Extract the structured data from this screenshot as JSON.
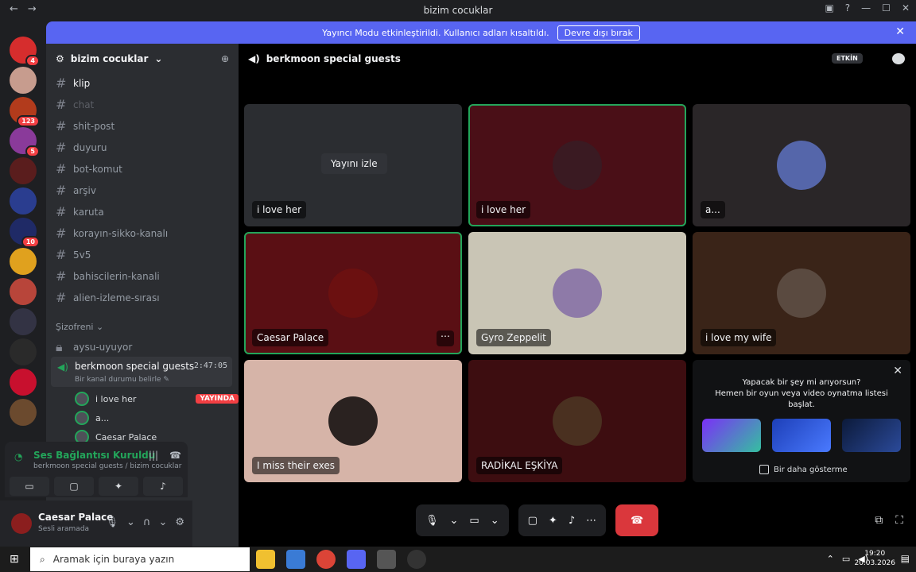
{
  "window": {
    "title": "bizim cocuklar",
    "back": "←",
    "forward": "→"
  },
  "notice": {
    "text": "Yayıncı Modu etkinleştirildi. Kullanıcı adları kısaltıldı.",
    "button": "Devre dışı bırak",
    "close": "✕"
  },
  "guilds": [
    {
      "color": "#d62d2d",
      "badge": "4"
    },
    {
      "color": "#c79c8e",
      "badge": ""
    },
    {
      "color": "#b23b1c",
      "badge": "123"
    },
    {
      "color": "#8a3a9a",
      "badge": "5"
    },
    {
      "color": "#5a1d1d",
      "badge": ""
    },
    {
      "color": "#2a3d8f",
      "badge": ""
    },
    {
      "color": "#1f2a66",
      "badge": "10"
    },
    {
      "color": "#e0a11e",
      "badge": ""
    },
    {
      "color": "#b8453a",
      "badge": ""
    },
    {
      "color": "#334",
      "badge": ""
    },
    {
      "color": "#2a2a2a",
      "badge": ""
    },
    {
      "color": "#c8102e",
      "badge": ""
    },
    {
      "color": "#6b4a2e",
      "badge": ""
    }
  ],
  "sidebar": {
    "server_name": "bizim cocuklar",
    "channels": [
      {
        "name": "klip",
        "state": "active"
      },
      {
        "name": "chat",
        "state": "dim"
      },
      {
        "name": "shit-post",
        "state": ""
      },
      {
        "name": "duyuru",
        "state": ""
      },
      {
        "name": "bot-komut",
        "state": ""
      },
      {
        "name": "arşiv",
        "state": ""
      },
      {
        "name": "karuta",
        "state": ""
      },
      {
        "name": "korayın-sikko-kanalı",
        "state": ""
      },
      {
        "name": "5v5",
        "state": ""
      },
      {
        "name": "bahiscilerin-kanali",
        "state": ""
      },
      {
        "name": "alien-izleme-sırası",
        "state": ""
      }
    ],
    "category": "Şizofreni ⌄",
    "locked_channel": "aysu-uyuyor",
    "voice_channel": {
      "name": "berkmoon special guests",
      "timer": "2:47:05",
      "status": "Bir kanal durumu belirle ✎"
    },
    "voice_users": [
      {
        "name": "i love her",
        "live": "YAYINDA"
      },
      {
        "name": "a...",
        "live": ""
      },
      {
        "name": "Caesar Palace",
        "live": ""
      }
    ]
  },
  "connection": {
    "status": "Ses Bağlantısı Kuruldu",
    "path": "berkmoon special guests / bizim cocuklar"
  },
  "user": {
    "name": "Caesar Palace",
    "status": "Sesli aramada"
  },
  "main": {
    "channel_title": "berkmoon special guests",
    "activity_badge": "ETKİN",
    "watch_button": "Yayını izle",
    "tiles": [
      {
        "label": "i love her",
        "bg": "#2b2d31",
        "avatar": ""
      },
      {
        "label": "i love her",
        "bg": "#4a0f17",
        "avatar": "#3a1a22"
      },
      {
        "label": "a...",
        "bg": "#2a2628",
        "avatar": "#5566aa"
      },
      {
        "label": "Caesar Palace",
        "bg": "#5a0f14",
        "avatar": "#6b1010"
      },
      {
        "label": "Gyro Zeppelit",
        "bg": "#c9c5b5",
        "avatar": "#8e7aa8"
      },
      {
        "label": "i love my wife",
        "bg": "#3a2418",
        "avatar": "#5a4a40"
      },
      {
        "label": "I miss their exes",
        "bg": "#d6b4a8",
        "avatar": "#2a2220"
      },
      {
        "label": "RADİKAL EŞKİYA",
        "bg": "#3d0d10",
        "avatar": "#4a3020"
      }
    ],
    "promo": {
      "text1": "Yapacak bir şey mi arıyorsun?",
      "text2": "Hemen bir oyun veya video oynatma listesi",
      "text3": "başlat.",
      "dont_show": "Bir daha gösterme"
    }
  },
  "taskbar": {
    "search_placeholder": "Aramak için buraya yazın",
    "time": "19:20",
    "date": "20.03.2026"
  }
}
